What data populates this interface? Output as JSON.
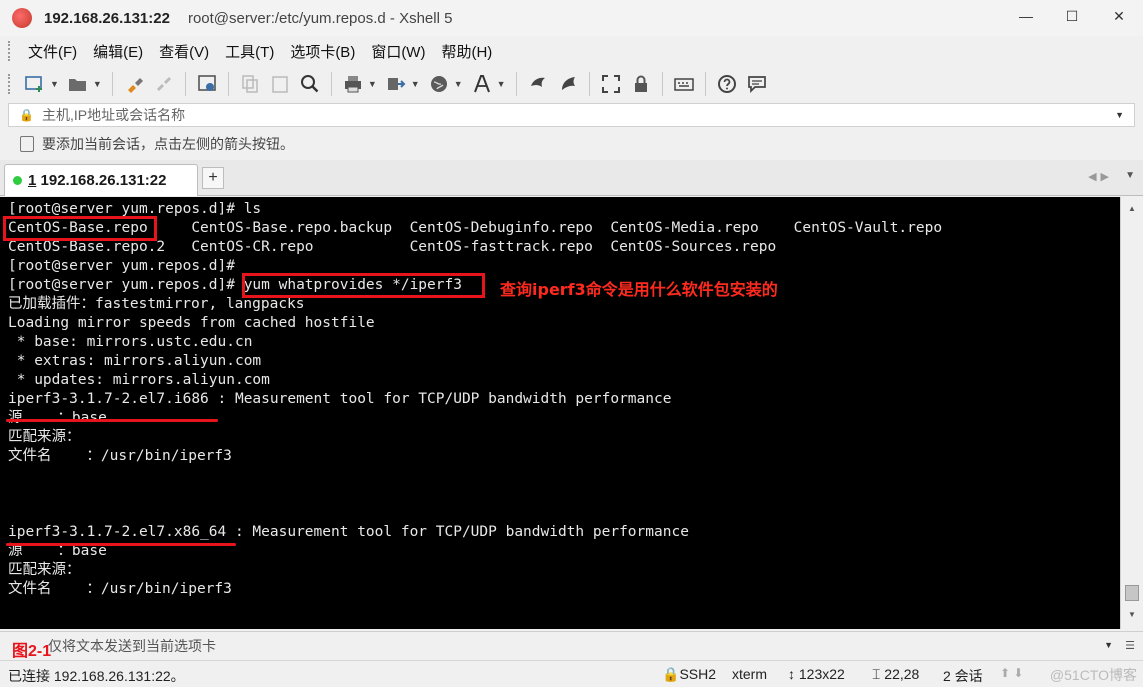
{
  "window": {
    "title_host": "192.168.26.131:22",
    "title_rest": "root@server:/etc/yum.repos.d - Xshell 5",
    "minimize_glyph": "—",
    "maximize_glyph": "☐",
    "close_glyph": "✕"
  },
  "menu": [
    "文件(F)",
    "编辑(E)",
    "查看(V)",
    "工具(T)",
    "选项卡(B)",
    "窗口(W)",
    "帮助(H)"
  ],
  "toolbar_icons": [
    "new-session-icon",
    "open-folder-icon",
    "reconnect-icon",
    "disconnect-icon",
    "properties-icon",
    "copy-icon",
    "paste-icon",
    "find-icon",
    "print-icon",
    "transfer-icon",
    "globe-icon",
    "font-icon",
    "xftp-icon",
    "xmanager-icon",
    "fullscreen-icon",
    "lock-icon",
    "keyboard-icon",
    "help-icon",
    "chat-icon"
  ],
  "address": {
    "placeholder": "主机,IP地址或会话名称"
  },
  "hint": {
    "text": "要添加当前会话，点击左侧的箭头按钮。"
  },
  "tab": {
    "number": "1",
    "label": "192.168.26.131:22",
    "status_color": "#2ecc40"
  },
  "terminal": {
    "lines": [
      "[root@server yum.repos.d]# ls",
      "CentOS-Base.repo     CentOS-Base.repo.backup  CentOS-Debuginfo.repo  CentOS-Media.repo    CentOS-Vault.repo",
      "CentOS-Base.repo.2   CentOS-CR.repo           CentOS-fasttrack.repo  CentOS-Sources.repo",
      "[root@server yum.repos.d]#",
      "[root@server yum.repos.d]# yum whatprovides */iperf3",
      "已加载插件：fastestmirror, langpacks",
      "Loading mirror speeds from cached hostfile",
      " * base: mirrors.ustc.edu.cn",
      " * extras: mirrors.aliyun.com",
      " * updates: mirrors.aliyun.com",
      "iperf3-3.1.7-2.el7.i686 : Measurement tool for TCP/UDP bandwidth performance",
      "源    ：base",
      "匹配来源：",
      "文件名    ：/usr/bin/iperf3",
      "",
      "",
      "",
      "iperf3-3.1.7-2.el7.x86_64 : Measurement tool for TCP/UDP bandwidth performance",
      "源    ：base",
      "匹配来源：",
      "文件名    ：/usr/bin/iperf3"
    ],
    "foreground": "#e8e8e8",
    "background": "#000000"
  },
  "annotation": {
    "note": "查询iperf3命令是用什么软件包安装的",
    "color": "#e8141b"
  },
  "compose": {
    "figure_label": "图2-1",
    "placeholder": "仅将文本发送到当前选项卡"
  },
  "status": {
    "connection": "已连接 192.168.26.131:22。",
    "protocol": "SSH2",
    "terminal_type": "xterm",
    "size": "123x22",
    "cursor": "22,28",
    "sessions": "2 会话",
    "watermark": "@51CTO博客"
  }
}
